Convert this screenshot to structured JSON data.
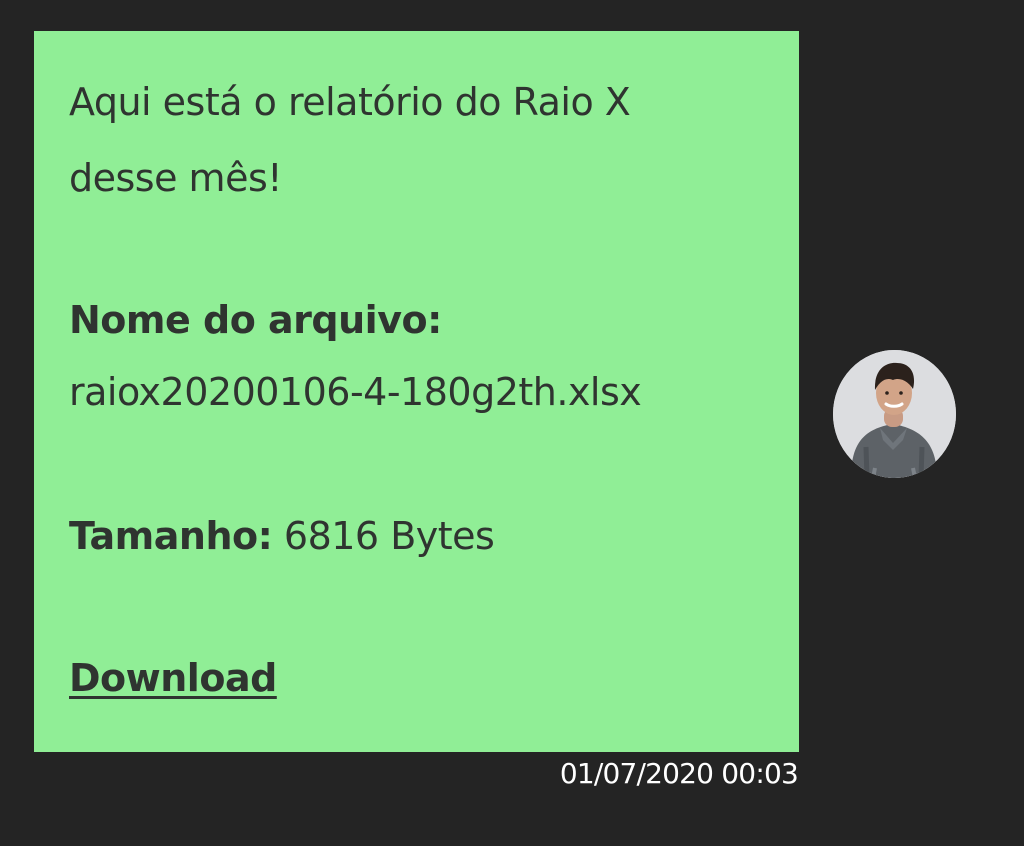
{
  "message": {
    "intro_line_1": "Aqui está o relatório do Raio X",
    "intro_line_2": "desse mês!",
    "file_name_label": "Nome do arquivo:",
    "file_name": "raiox20200106-4-180g2th.xlsx",
    "size_label": "Tamanho:",
    "size_value": "6816 Bytes",
    "download_label": "Download",
    "timestamp": "01/07/2020 00:03"
  },
  "colors": {
    "background": "#242424",
    "bubble": "#90ee96",
    "text": "#2f3430",
    "timestamp": "#ffffff"
  }
}
